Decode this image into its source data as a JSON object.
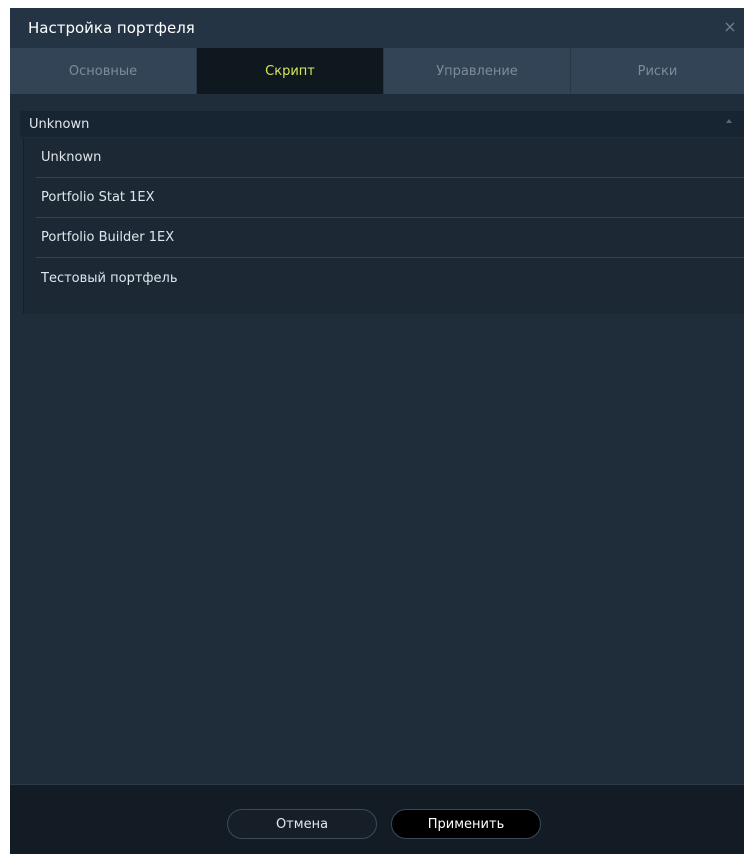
{
  "window": {
    "title": "Настройка портфеля",
    "close_glyph": "×"
  },
  "tabs": [
    {
      "label": "Основные",
      "active": false
    },
    {
      "label": "Скрипт",
      "active": true
    },
    {
      "label": "Управление",
      "active": false
    },
    {
      "label": "Риски",
      "active": false
    }
  ],
  "script_select": {
    "selected": "Unknown",
    "expanded": true,
    "options": [
      "Unknown",
      "Portfolio Stat 1EX",
      "Portfolio Builder 1EX",
      "Тестовый портфель"
    ]
  },
  "footer": {
    "cancel_label": "Отмена",
    "apply_label": "Применить"
  },
  "colors": {
    "background": "#1f2d3b",
    "tab_bar": "#324456",
    "active_tab_bg": "#0f171f",
    "active_tab_text": "#d8e65a",
    "footer_bg": "#131c25"
  },
  "icons": {
    "close": "close-icon",
    "dropdown_arrow": "chevron-up-icon"
  }
}
